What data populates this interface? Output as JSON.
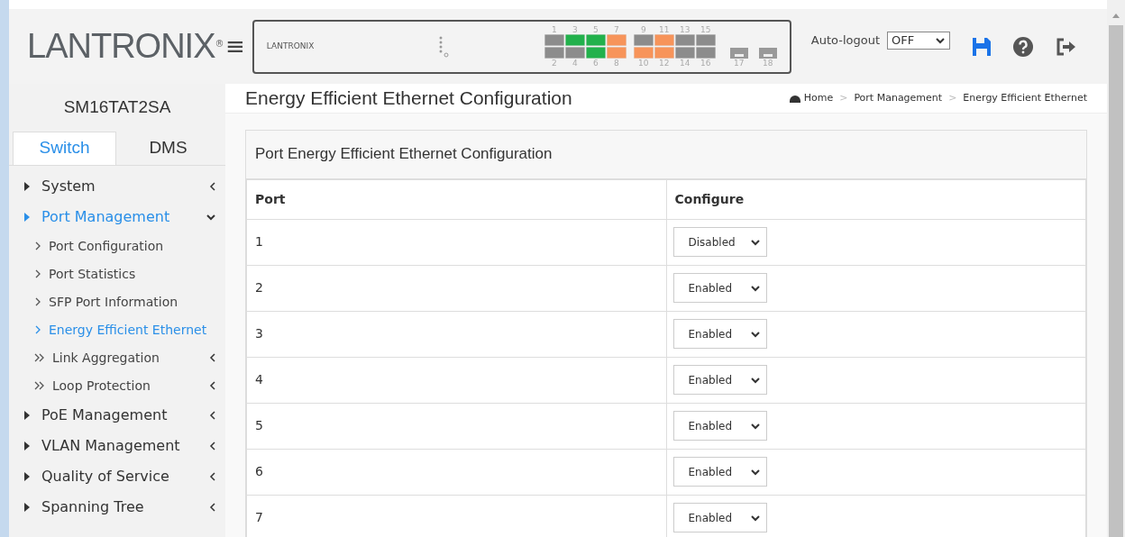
{
  "header": {
    "logo": "LANTRONIX",
    "logo_mark": "®",
    "menu_glyph": "≡",
    "panel_logo": "LANTRONIX",
    "ports_top": [
      {
        "label": "1",
        "color": "#8c8c8c"
      },
      {
        "label": "3",
        "color": "#22b14c"
      },
      {
        "label": "5",
        "color": "#22b14c"
      },
      {
        "label": "7",
        "color": "#f7945a"
      },
      {
        "label": "9",
        "color": "#8c8c8c"
      },
      {
        "label": "11",
        "color": "#f7945a"
      },
      {
        "label": "13",
        "color": "#8c8c8c"
      },
      {
        "label": "15",
        "color": "#8c8c8c"
      }
    ],
    "ports_bottom": [
      {
        "label": "2",
        "color": "#8c8c8c"
      },
      {
        "label": "4",
        "color": "#8c8c8c"
      },
      {
        "label": "6",
        "color": "#22b14c"
      },
      {
        "label": "8",
        "color": "#f7945a"
      },
      {
        "label": "10",
        "color": "#f7945a"
      },
      {
        "label": "12",
        "color": "#f7945a"
      },
      {
        "label": "14",
        "color": "#8c8c8c"
      },
      {
        "label": "16",
        "color": "#8c8c8c"
      }
    ],
    "sfp_ports": [
      "17",
      "18"
    ],
    "auto_logout": {
      "label": "Auto-logout",
      "value": "OFF"
    }
  },
  "sidebar": {
    "device": "SM16TAT2SA",
    "tabs": [
      {
        "label": "Switch",
        "selected": true
      },
      {
        "label": "DMS",
        "selected": false
      }
    ],
    "items": [
      {
        "label": "System",
        "expanded": false,
        "selected": false
      },
      {
        "label": "Port Management",
        "expanded": true,
        "selected": true,
        "children": [
          {
            "label": "Port Configuration",
            "kind": "page",
            "selected": false
          },
          {
            "label": "Port Statistics",
            "kind": "page",
            "selected": false
          },
          {
            "label": "SFP Port Information",
            "kind": "page",
            "selected": false
          },
          {
            "label": "Energy Efficient Ethernet",
            "kind": "page",
            "selected": true
          },
          {
            "label": "Link Aggregation",
            "kind": "group",
            "selected": false
          },
          {
            "label": "Loop Protection",
            "kind": "group",
            "selected": false
          }
        ]
      },
      {
        "label": "PoE Management",
        "expanded": false,
        "selected": false
      },
      {
        "label": "VLAN Management",
        "expanded": false,
        "selected": false
      },
      {
        "label": "Quality of Service",
        "expanded": false,
        "selected": false
      },
      {
        "label": "Spanning Tree",
        "expanded": false,
        "selected": false
      }
    ]
  },
  "page": {
    "title": "Energy Efficient Ethernet Configuration",
    "breadcrumb": [
      "Home",
      "Port Management",
      "Energy Efficient Ethernet"
    ],
    "breadcrumb_separator": ">",
    "panel_title": "Port Energy Efficient Ethernet Configuration",
    "table": {
      "columns": [
        "Port",
        "Configure"
      ],
      "rows": [
        {
          "port": "1",
          "configure": "Disabled"
        },
        {
          "port": "2",
          "configure": "Enabled"
        },
        {
          "port": "3",
          "configure": "Enabled"
        },
        {
          "port": "4",
          "configure": "Enabled"
        },
        {
          "port": "5",
          "configure": "Enabled"
        },
        {
          "port": "6",
          "configure": "Enabled"
        },
        {
          "port": "7",
          "configure": "Enabled"
        }
      ]
    }
  }
}
